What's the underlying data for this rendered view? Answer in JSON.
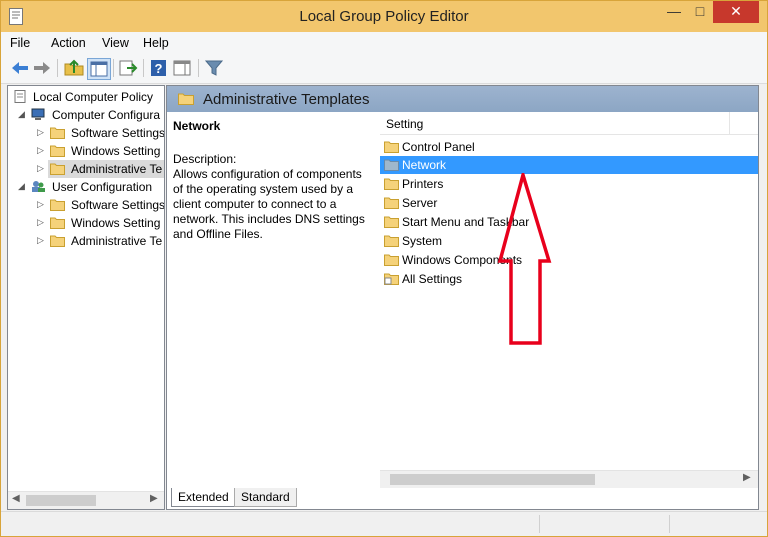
{
  "window": {
    "title": "Local Group Policy Editor"
  },
  "menu": [
    "File",
    "Action",
    "View",
    "Help"
  ],
  "toolbar": {
    "buttons": [
      "back-icon",
      "forward-icon",
      "up-folder-icon",
      "show-hide-tree-icon",
      "export-list-icon",
      "help-icon",
      "show-hide-action-pane-icon",
      "filter-icon"
    ]
  },
  "tree": {
    "root": "Local Computer Policy",
    "computer_config": "Computer Configura",
    "computer_children": [
      "Software Settings",
      "Windows Setting",
      "Administrative Te"
    ],
    "user_config": "User Configuration",
    "user_children": [
      "Software Settings",
      "Windows Setting",
      "Administrative Te"
    ]
  },
  "right": {
    "header_title": "Administrative Templates",
    "selected_name": "Network",
    "description_label": "Description:",
    "description_lines": [
      "Allows configuration of components",
      "of the operating system used by a",
      "client computer to connect to a",
      "network. This includes DNS settings",
      "and Offline Files."
    ],
    "column_header": "Setting",
    "items": [
      "Control Panel",
      "Network",
      "Printers",
      "Server",
      "Start Menu and Taskbar",
      "System",
      "Windows Components",
      "All Settings"
    ],
    "selected_index": 1
  },
  "tabs": {
    "extended": "Extended",
    "standard": "Standard"
  },
  "colors": {
    "titlebar": "#f2c66d",
    "selection": "#3399ff",
    "header_band": "#9db3cf",
    "annotation_arrow": "#e8001c"
  }
}
